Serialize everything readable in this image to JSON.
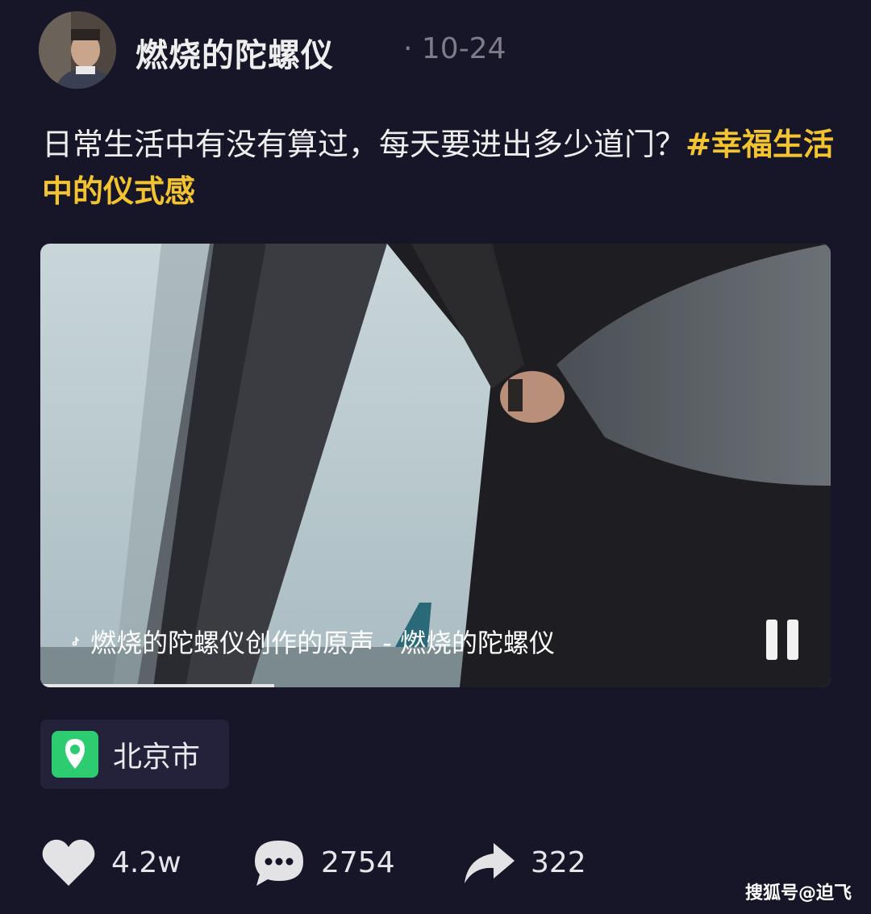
{
  "author": {
    "name": "燃烧的陀螺仪",
    "date": "· 10-24"
  },
  "post": {
    "caption_text": "日常生活中有没有算过，每天要进出多少道门？",
    "hashtag": "#幸福生活中的仪式感"
  },
  "video": {
    "music_text": "燃烧的陀螺仪创作的原声 - 燃烧的陀螺仪",
    "play_state": "playing"
  },
  "location": {
    "name": "北京市",
    "icon": "map-pin-icon",
    "color": "#2ecc71"
  },
  "stats": {
    "likes": "4.2w",
    "comments": "2754",
    "shares": "322"
  },
  "watermark": "搜狐号@迫飞",
  "colors": {
    "background": "#171628",
    "hashtag": "#f4c430",
    "location_pin": "#2ecc71"
  }
}
